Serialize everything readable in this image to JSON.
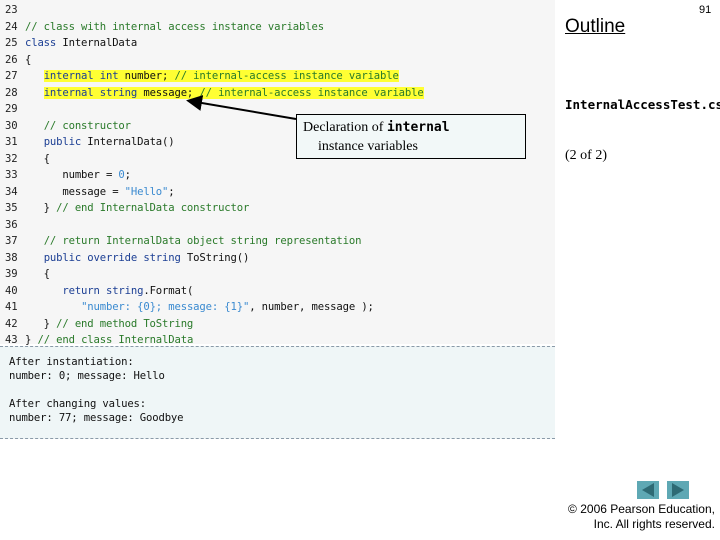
{
  "slide": {
    "page_number": "91",
    "outline_label": "Outline",
    "filename": "InternalAccessTest.cs",
    "part_label": "(2 of 2)",
    "copyright_line1": "© 2006 Pearson Education,",
    "copyright_line2": "Inc.  All rights reserved.",
    "nav": {
      "prev_icon": "triangle-left",
      "next_icon": "triangle-right",
      "button_color": "#5ea8b4"
    }
  },
  "code": {
    "lines": [
      {
        "n": "23",
        "segments": []
      },
      {
        "n": "24",
        "segments": [
          {
            "t": "// class with internal access instance variables",
            "c": "cm"
          }
        ]
      },
      {
        "n": "25",
        "segments": [
          {
            "t": "class",
            "c": "kw"
          },
          {
            "t": " InternalData",
            "c": ""
          }
        ]
      },
      {
        "n": "26",
        "segments": [
          {
            "t": "{",
            "c": ""
          }
        ]
      },
      {
        "n": "27",
        "segments": [
          {
            "t": "   ",
            "c": ""
          },
          {
            "t": "internal int",
            "c": "kw hl"
          },
          {
            "t": " number; ",
            "c": "hl"
          },
          {
            "t": "// internal-access instance variable",
            "c": "cm hl"
          }
        ]
      },
      {
        "n": "28",
        "segments": [
          {
            "t": "   ",
            "c": ""
          },
          {
            "t": "internal string",
            "c": "kw hl"
          },
          {
            "t": " message; ",
            "c": "hl"
          },
          {
            "t": "// internal-access instance variable",
            "c": "cm hl"
          }
        ]
      },
      {
        "n": "29",
        "segments": []
      },
      {
        "n": "30",
        "segments": [
          {
            "t": "   ",
            "c": ""
          },
          {
            "t": "// constructor",
            "c": "cm"
          }
        ]
      },
      {
        "n": "31",
        "segments": [
          {
            "t": "   ",
            "c": ""
          },
          {
            "t": "public",
            "c": "kw"
          },
          {
            "t": " InternalData()",
            "c": ""
          }
        ]
      },
      {
        "n": "32",
        "segments": [
          {
            "t": "   {",
            "c": ""
          }
        ]
      },
      {
        "n": "33",
        "segments": [
          {
            "t": "      number = ",
            "c": ""
          },
          {
            "t": "0",
            "c": "num"
          },
          {
            "t": ";",
            "c": ""
          }
        ]
      },
      {
        "n": "34",
        "segments": [
          {
            "t": "      message = ",
            "c": ""
          },
          {
            "t": "\"Hello\"",
            "c": "st"
          },
          {
            "t": ";",
            "c": ""
          }
        ]
      },
      {
        "n": "35",
        "segments": [
          {
            "t": "   } ",
            "c": ""
          },
          {
            "t": "// end InternalData constructor",
            "c": "cm"
          }
        ]
      },
      {
        "n": "36",
        "segments": []
      },
      {
        "n": "37",
        "segments": [
          {
            "t": "   ",
            "c": ""
          },
          {
            "t": "// return InternalData object string representation",
            "c": "cm"
          }
        ]
      },
      {
        "n": "38",
        "segments": [
          {
            "t": "   ",
            "c": ""
          },
          {
            "t": "public override string",
            "c": "kw"
          },
          {
            "t": " ToString()",
            "c": ""
          }
        ]
      },
      {
        "n": "39",
        "segments": [
          {
            "t": "   {",
            "c": ""
          }
        ]
      },
      {
        "n": "40",
        "segments": [
          {
            "t": "      ",
            "c": ""
          },
          {
            "t": "return string",
            "c": "kw"
          },
          {
            "t": ".Format(",
            "c": ""
          }
        ]
      },
      {
        "n": "41",
        "segments": [
          {
            "t": "         ",
            "c": ""
          },
          {
            "t": "\"number: {0}; message: {1}\"",
            "c": "st"
          },
          {
            "t": ", number, message );",
            "c": ""
          }
        ]
      },
      {
        "n": "42",
        "segments": [
          {
            "t": "   } ",
            "c": ""
          },
          {
            "t": "// end method ToString",
            "c": "cm"
          }
        ]
      },
      {
        "n": "43",
        "segments": [
          {
            "t": "} ",
            "c": ""
          },
          {
            "t": "// end class InternalData",
            "c": "cm"
          }
        ]
      }
    ]
  },
  "output": {
    "lines": [
      "After instantiation:",
      "number: 0; message: Hello",
      "",
      "After changing values:",
      "number: 77; message: Goodbye"
    ]
  },
  "callout": {
    "text_before": "Declaration of ",
    "keyword": "internal",
    "text_line2": "instance variables"
  },
  "colors": {
    "keyword": "#1c3f94",
    "comment": "#2a7a2a",
    "string": "#3a8ad0",
    "highlight": "#ffff33"
  }
}
